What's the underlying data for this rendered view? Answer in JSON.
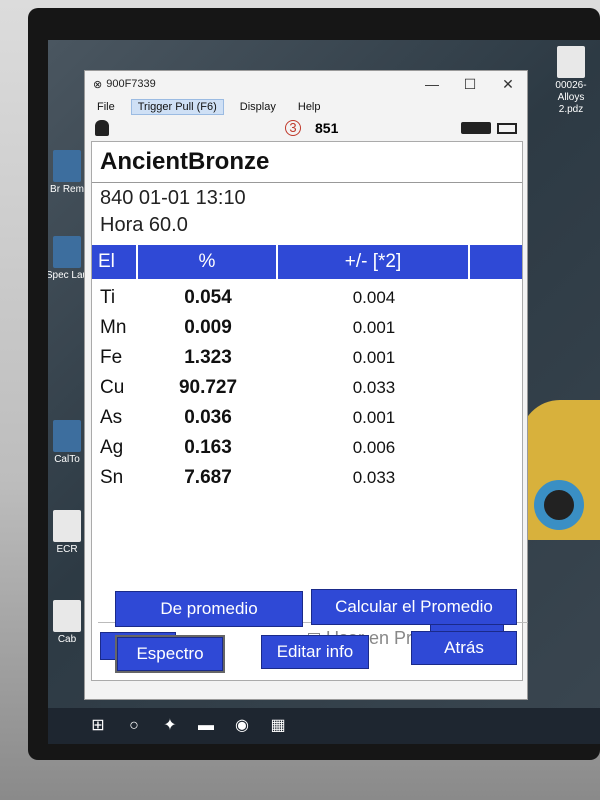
{
  "window": {
    "title": "900F7339",
    "controls": {
      "minimize": "—",
      "maximize": "☐",
      "close": "✕"
    }
  },
  "menu": [
    "File",
    "Trigger Pull (F6)",
    "Display",
    "Help"
  ],
  "status": {
    "warning_count": "3",
    "reading_number": "851"
  },
  "alloy": {
    "name": "AncientBronze",
    "test_line": "840   01-01 13:10",
    "time_line": "Hora 60.0"
  },
  "table": {
    "headers": [
      "El",
      "%",
      "+/- [*2]"
    ],
    "rows": [
      {
        "el": "Ti",
        "pct": "0.054",
        "err": "0.004"
      },
      {
        "el": "Mn",
        "pct": "0.009",
        "err": "0.001"
      },
      {
        "el": "Fe",
        "pct": "1.323",
        "err": "0.001"
      },
      {
        "el": "Cu",
        "pct": "90.727",
        "err": "0.033"
      },
      {
        "el": "As",
        "pct": "0.036",
        "err": "0.001"
      },
      {
        "el": "Ag",
        "pct": "0.163",
        "err": "0.006"
      },
      {
        "el": "Sn",
        "pct": "7.687",
        "err": "0.033"
      }
    ]
  },
  "buttons": {
    "prev": "<",
    "next": ">",
    "use_in_average": "Usar en Promedio",
    "from_average": "De promedio",
    "calc_average": "Calcular el Promedio",
    "spectrum": "Espectro",
    "edit_info": "Editar info",
    "back": "Atrás"
  },
  "desktop": {
    "file_icon_label": "00026-Alloys 2.pdz",
    "side_labels": [
      "Br Rem",
      "Spec Lau",
      "CalTo",
      "ECR",
      "Cab"
    ]
  },
  "colors": {
    "accent": "#2f49d6",
    "warning": "#c0392b"
  }
}
